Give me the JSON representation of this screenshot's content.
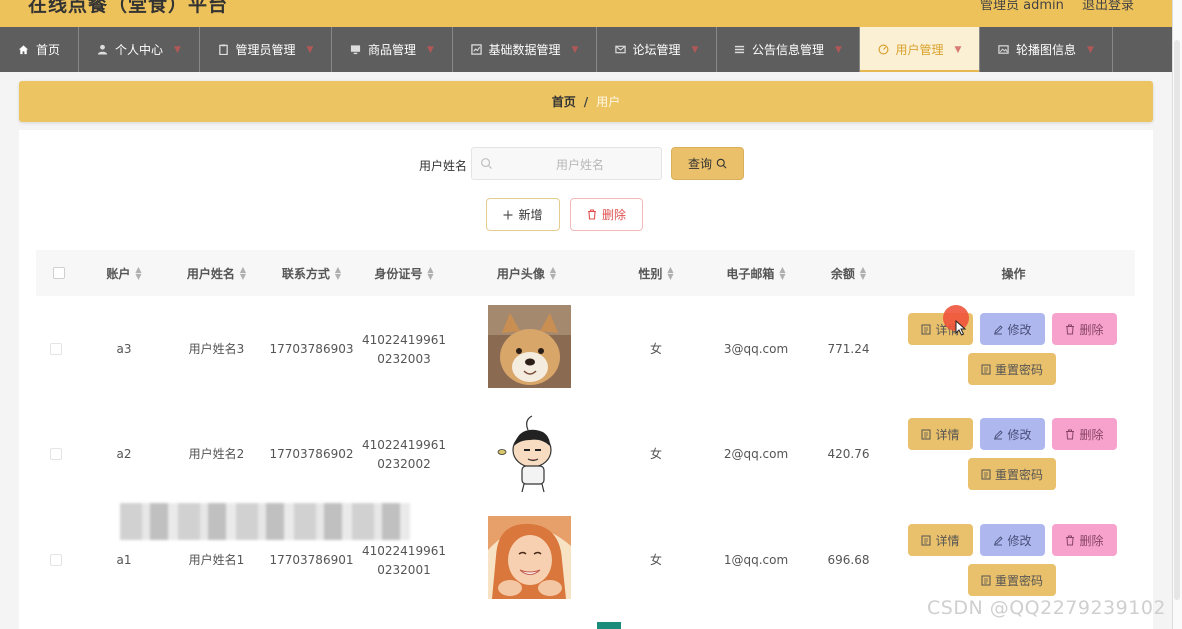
{
  "header": {
    "site_title": "在线点餐（堂食）平台",
    "user_text": "管理员 admin",
    "logout_label": "退出登录"
  },
  "nav": {
    "items": [
      {
        "label": "首页",
        "icon": "home-icon"
      },
      {
        "label": "个人中心",
        "icon": "person-icon"
      },
      {
        "label": "管理员管理",
        "icon": "clipboard-icon"
      },
      {
        "label": "商品管理",
        "icon": "monitor-icon"
      },
      {
        "label": "基础数据管理",
        "icon": "chart-icon"
      },
      {
        "label": "论坛管理",
        "icon": "mail-icon"
      },
      {
        "label": "公告信息管理",
        "icon": "list-icon"
      },
      {
        "label": "用户管理",
        "icon": "dashboard-icon"
      },
      {
        "label": "轮播图信息",
        "icon": "image-icon"
      }
    ],
    "active_index": 7
  },
  "breadcrumb": {
    "home": "首页",
    "separator": "/",
    "current": "用户"
  },
  "search": {
    "label": "用户姓名",
    "placeholder": "用户姓名",
    "value": "",
    "query_label": "查询"
  },
  "toolbar": {
    "add_label": "新增",
    "delete_label": "删除"
  },
  "table": {
    "columns": [
      "账户",
      "用户姓名",
      "联系方式",
      "身份证号",
      "用户头像",
      "性别",
      "电子邮箱",
      "余额",
      "操作"
    ],
    "rows": [
      {
        "account": "a3",
        "name": "用户姓名3",
        "phone": "17703786903",
        "id_line1": "41022419961",
        "id_line2": "0232003",
        "avatar": "shiba-dog-photo",
        "gender": "女",
        "email": "3@qq.com",
        "balance": "771.24"
      },
      {
        "account": "a2",
        "name": "用户姓名2",
        "phone": "17703786902",
        "id_line1": "41022419961",
        "id_line2": "0232002",
        "avatar": "cartoon-boy-sticker",
        "gender": "女",
        "email": "2@qq.com",
        "balance": "420.76"
      },
      {
        "account": "a1",
        "name": "用户姓名1",
        "phone": "17703786901",
        "id_line1": "41022419961",
        "id_line2": "0232001",
        "avatar": "smiling-woman-photo",
        "gender": "女",
        "email": "1@qq.com",
        "balance": "696.68"
      }
    ],
    "actions": {
      "detail": "详情",
      "edit": "修改",
      "delete": "删除",
      "reset_password": "重置密码"
    }
  },
  "watermark": "CSDN @QQ2279239102",
  "colors": {
    "accent": "#eec25a",
    "nav_bg": "#5e5e5e",
    "edit_btn": "#aeb8ee",
    "delete_btn": "#f7a2cd",
    "delete_text": "#e05050"
  }
}
